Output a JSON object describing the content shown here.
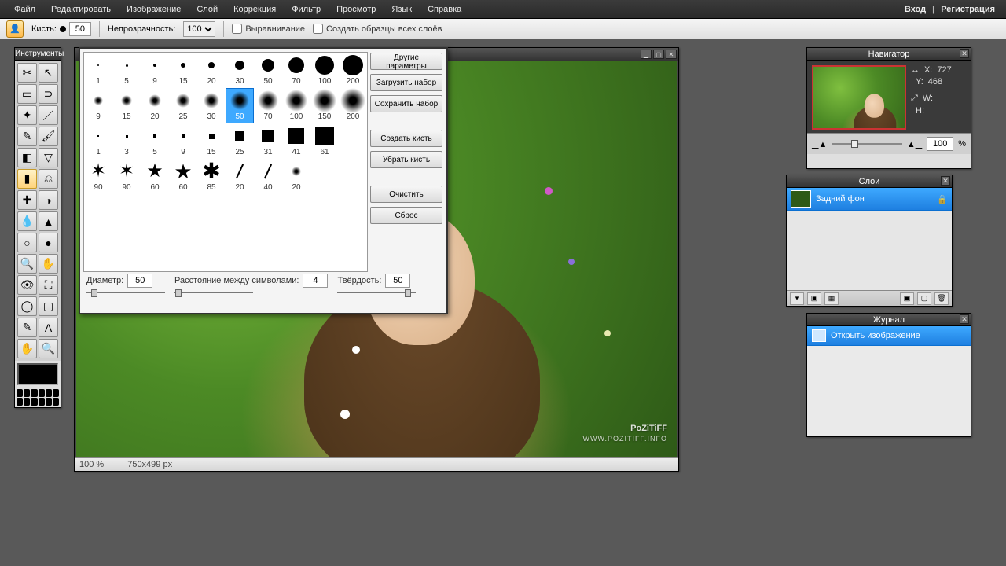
{
  "menu": {
    "items": [
      "Файл",
      "Редактировать",
      "Изображение",
      "Слой",
      "Коррекция",
      "Фильтр",
      "Просмотр",
      "Язык",
      "Справка"
    ],
    "login": "Вход",
    "register": "Регистрация"
  },
  "optbar": {
    "brush_label": "Кисть:",
    "brush_size": "50",
    "opacity_label": "Непрозрачность:",
    "opacity_value": "100",
    "align": "Выравнивание",
    "sample_all": "Создать образцы всех слоёв"
  },
  "toolbox": {
    "title": "Инструменты",
    "tools": [
      {
        "n": "crop",
        "g": "✂"
      },
      {
        "n": "move",
        "g": "↖"
      },
      {
        "n": "marquee",
        "g": "▭"
      },
      {
        "n": "lasso",
        "g": "⊃"
      },
      {
        "n": "wand",
        "g": "✦"
      },
      {
        "n": "line",
        "g": "／"
      },
      {
        "n": "pencil",
        "g": "✎"
      },
      {
        "n": "brush",
        "g": "🖌"
      },
      {
        "n": "eraser",
        "g": "◧"
      },
      {
        "n": "bucket",
        "g": "▽"
      },
      {
        "n": "gradient",
        "g": "▮",
        "sel": true
      },
      {
        "n": "stamp",
        "g": "⎌"
      },
      {
        "n": "heal",
        "g": "✚"
      },
      {
        "n": "patch",
        "g": "◑"
      },
      {
        "n": "blur",
        "g": "💧"
      },
      {
        "n": "sharpen",
        "g": "▲"
      },
      {
        "n": "dodge",
        "g": "○"
      },
      {
        "n": "sponge",
        "g": "●"
      },
      {
        "n": "zoom",
        "g": "🔍"
      },
      {
        "n": "hand",
        "g": "✋"
      },
      {
        "n": "eye",
        "g": "👁"
      },
      {
        "n": "transform",
        "g": "⛶"
      },
      {
        "n": "shape",
        "g": "◯"
      },
      {
        "n": "rect",
        "g": "▢"
      },
      {
        "n": "picker",
        "g": "✎"
      },
      {
        "n": "text",
        "g": "A"
      },
      {
        "n": "pan",
        "g": "✋"
      },
      {
        "n": "zoom2",
        "g": "🔍"
      }
    ]
  },
  "doc": {
    "zoom": "100 %",
    "dims": "750x499 px",
    "watermark_brand": "PoZiTiFF",
    "watermark_url": "WWW.POZITIFF.INFO"
  },
  "brushpop": {
    "rows": [
      [
        {
          "s": 2,
          "t": "c",
          "l": "1"
        },
        {
          "s": 3,
          "t": "c",
          "l": "5"
        },
        {
          "s": 4,
          "t": "c",
          "l": "9"
        },
        {
          "s": 6,
          "t": "c",
          "l": "15"
        },
        {
          "s": 8,
          "t": "c",
          "l": "20"
        },
        {
          "s": 12,
          "t": "c",
          "l": "30"
        },
        {
          "s": 16,
          "t": "c",
          "l": "50"
        },
        {
          "s": 20,
          "t": "c",
          "l": "70"
        },
        {
          "s": 24,
          "t": "c",
          "l": "100"
        },
        {
          "s": 26,
          "t": "c",
          "l": "200"
        }
      ],
      [
        {
          "s": 4,
          "t": "b",
          "l": "9"
        },
        {
          "s": 6,
          "t": "b",
          "l": "15"
        },
        {
          "s": 8,
          "t": "b",
          "l": "20"
        },
        {
          "s": 10,
          "t": "b",
          "l": "25"
        },
        {
          "s": 12,
          "t": "b",
          "l": "30"
        },
        {
          "s": 16,
          "t": "b",
          "l": "50",
          "sel": true
        },
        {
          "s": 18,
          "t": "b",
          "l": "70"
        },
        {
          "s": 20,
          "t": "b",
          "l": "100"
        },
        {
          "s": 22,
          "t": "b",
          "l": "150"
        },
        {
          "s": 24,
          "t": "b",
          "l": "200"
        }
      ],
      [
        {
          "s": 2,
          "t": "s",
          "l": "1"
        },
        {
          "s": 3,
          "t": "s",
          "l": "3"
        },
        {
          "s": 4,
          "t": "s",
          "l": "5"
        },
        {
          "s": 5,
          "t": "s",
          "l": "9"
        },
        {
          "s": 7,
          "t": "s",
          "l": "15"
        },
        {
          "s": 12,
          "t": "s",
          "l": "25"
        },
        {
          "s": 16,
          "t": "s",
          "l": "31"
        },
        {
          "s": 20,
          "t": "s",
          "l": "41"
        },
        {
          "s": 24,
          "t": "s",
          "l": "61"
        },
        {
          "s": 0,
          "t": "e",
          "l": ""
        }
      ],
      [
        {
          "s": 18,
          "t": "st",
          "l": "90"
        },
        {
          "s": 18,
          "t": "st",
          "l": "90"
        },
        {
          "s": 18,
          "t": "st5",
          "l": "60"
        },
        {
          "s": 20,
          "t": "st5",
          "l": "60"
        },
        {
          "s": 22,
          "t": "fl",
          "l": "85"
        },
        {
          "s": 0,
          "t": "sl",
          "l": "20"
        },
        {
          "s": 0,
          "t": "sl",
          "l": "40"
        },
        {
          "s": 4,
          "t": "b",
          "l": "20"
        },
        {
          "s": 0,
          "t": "e",
          "l": ""
        },
        {
          "s": 0,
          "t": "e",
          "l": ""
        }
      ]
    ],
    "side": [
      "Другие параметры",
      "Загрузить набор",
      "Сохранить набор",
      "Создать кисть",
      "Убрать кисть",
      "Очистить",
      "Сброс"
    ],
    "diameter_label": "Диаметр:",
    "diameter_value": "50",
    "spacing_label": "Расстояние между символами:",
    "spacing_value": "4",
    "hardness_label": "Твёрдость:",
    "hardness_value": "50"
  },
  "navigator": {
    "title": "Навигатор",
    "x_label": "X:",
    "x": "727",
    "y_label": "Y:",
    "y": "468",
    "w_label": "W:",
    "h_label": "H:",
    "zoom": "100",
    "pct": "%"
  },
  "layers": {
    "title": "Слои",
    "layer0": "Задний фон"
  },
  "history": {
    "title": "Журнал",
    "item0": "Открыть изображение"
  }
}
